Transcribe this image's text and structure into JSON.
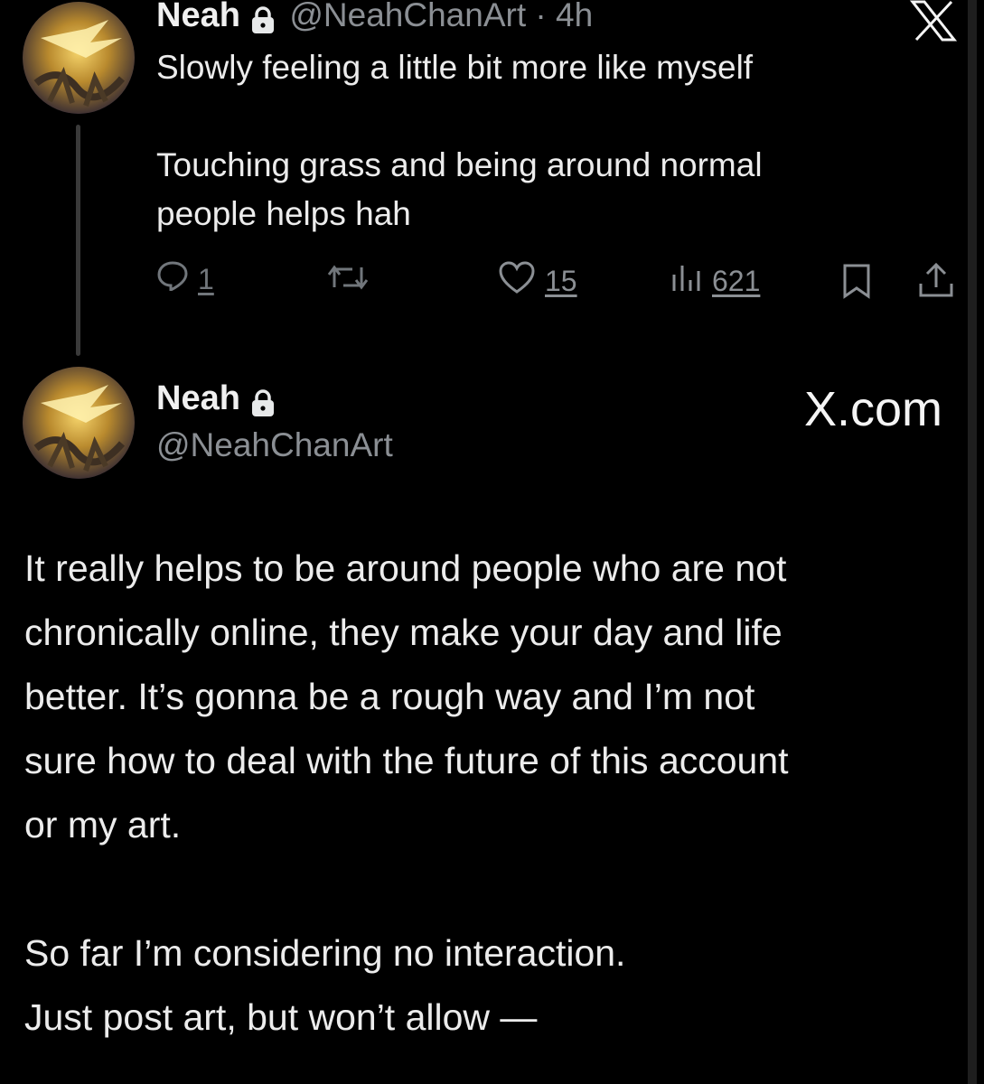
{
  "tweet1": {
    "name": "Neah",
    "handle": "@NeahChanArt",
    "time": "4h",
    "line1": "Slowly feeling a little bit more like myself",
    "line2": "Touching grass and being around normal",
    "line3": "people helps hah",
    "actions": {
      "replies": "1",
      "likes": "15",
      "views": "621"
    }
  },
  "tweet2": {
    "name": "Neah",
    "handle": "@NeahChanArt",
    "brand": "X.com",
    "paragraph1": [
      "It really helps to be around people who are not",
      "chronically online, they make your day and life",
      "better. It’s gonna be a rough way and I’m not",
      "sure how to deal with the future of this account",
      "or my art."
    ],
    "paragraph2": [
      "So far I’m considering no interaction.",
      "Just post art, but won’t allow —"
    ]
  },
  "icons": {
    "top_right": "x-logo-icon",
    "lock": "lock-icon",
    "reply": "reply-icon",
    "retweet": "retweet-icon",
    "like": "heart-icon",
    "views": "views-icon",
    "bookmark": "bookmark-icon",
    "share": "share-icon"
  },
  "colors": {
    "background": "#000000",
    "text": "#e7e9ea",
    "muted": "#71767b"
  }
}
